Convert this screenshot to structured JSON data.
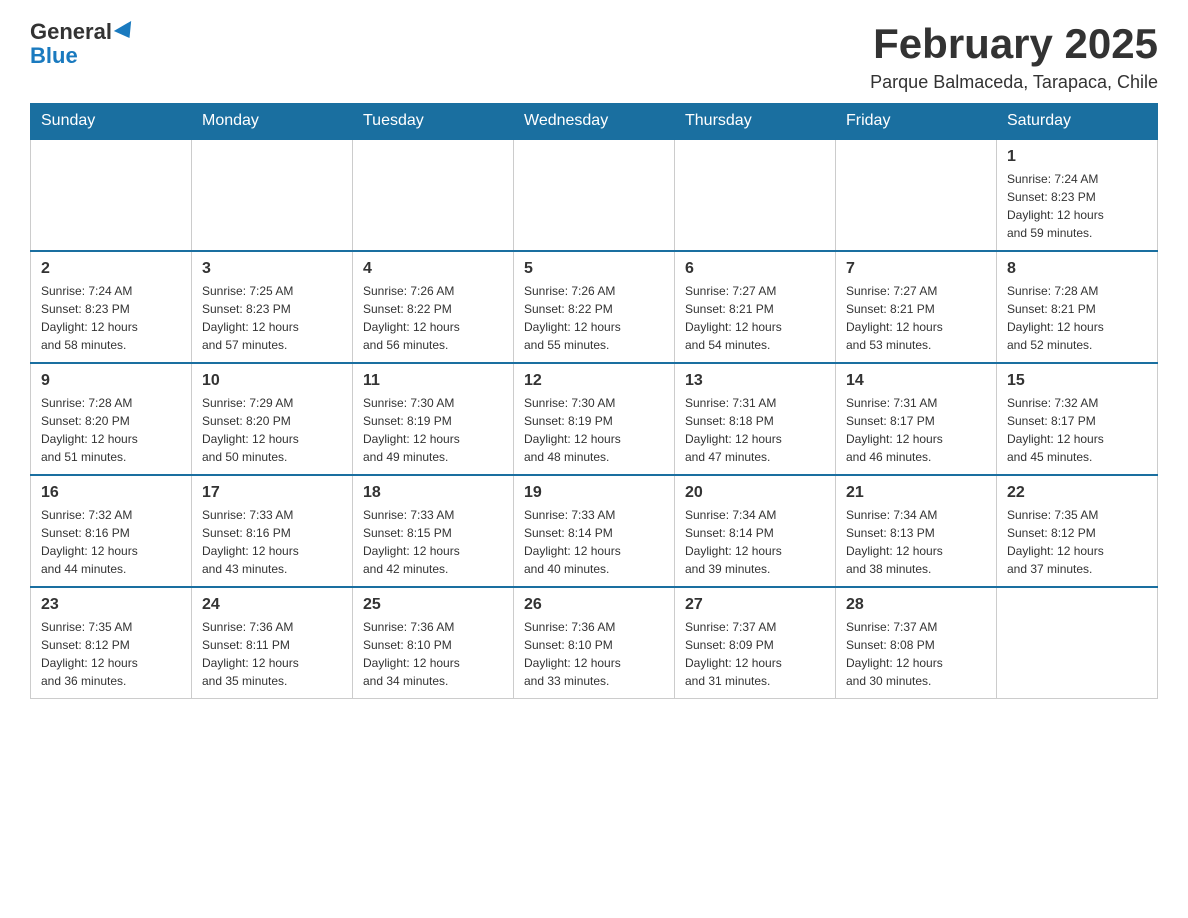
{
  "logo": {
    "general": "General",
    "blue": "Blue",
    "triangle_char": "▶"
  },
  "title": "February 2025",
  "subtitle": "Parque Balmaceda, Tarapaca, Chile",
  "days_of_week": [
    "Sunday",
    "Monday",
    "Tuesday",
    "Wednesday",
    "Thursday",
    "Friday",
    "Saturday"
  ],
  "weeks": [
    [
      {
        "day": "",
        "info": ""
      },
      {
        "day": "",
        "info": ""
      },
      {
        "day": "",
        "info": ""
      },
      {
        "day": "",
        "info": ""
      },
      {
        "day": "",
        "info": ""
      },
      {
        "day": "",
        "info": ""
      },
      {
        "day": "1",
        "info": "Sunrise: 7:24 AM\nSunset: 8:23 PM\nDaylight: 12 hours\nand 59 minutes."
      }
    ],
    [
      {
        "day": "2",
        "info": "Sunrise: 7:24 AM\nSunset: 8:23 PM\nDaylight: 12 hours\nand 58 minutes."
      },
      {
        "day": "3",
        "info": "Sunrise: 7:25 AM\nSunset: 8:23 PM\nDaylight: 12 hours\nand 57 minutes."
      },
      {
        "day": "4",
        "info": "Sunrise: 7:26 AM\nSunset: 8:22 PM\nDaylight: 12 hours\nand 56 minutes."
      },
      {
        "day": "5",
        "info": "Sunrise: 7:26 AM\nSunset: 8:22 PM\nDaylight: 12 hours\nand 55 minutes."
      },
      {
        "day": "6",
        "info": "Sunrise: 7:27 AM\nSunset: 8:21 PM\nDaylight: 12 hours\nand 54 minutes."
      },
      {
        "day": "7",
        "info": "Sunrise: 7:27 AM\nSunset: 8:21 PM\nDaylight: 12 hours\nand 53 minutes."
      },
      {
        "day": "8",
        "info": "Sunrise: 7:28 AM\nSunset: 8:21 PM\nDaylight: 12 hours\nand 52 minutes."
      }
    ],
    [
      {
        "day": "9",
        "info": "Sunrise: 7:28 AM\nSunset: 8:20 PM\nDaylight: 12 hours\nand 51 minutes."
      },
      {
        "day": "10",
        "info": "Sunrise: 7:29 AM\nSunset: 8:20 PM\nDaylight: 12 hours\nand 50 minutes."
      },
      {
        "day": "11",
        "info": "Sunrise: 7:30 AM\nSunset: 8:19 PM\nDaylight: 12 hours\nand 49 minutes."
      },
      {
        "day": "12",
        "info": "Sunrise: 7:30 AM\nSunset: 8:19 PM\nDaylight: 12 hours\nand 48 minutes."
      },
      {
        "day": "13",
        "info": "Sunrise: 7:31 AM\nSunset: 8:18 PM\nDaylight: 12 hours\nand 47 minutes."
      },
      {
        "day": "14",
        "info": "Sunrise: 7:31 AM\nSunset: 8:17 PM\nDaylight: 12 hours\nand 46 minutes."
      },
      {
        "day": "15",
        "info": "Sunrise: 7:32 AM\nSunset: 8:17 PM\nDaylight: 12 hours\nand 45 minutes."
      }
    ],
    [
      {
        "day": "16",
        "info": "Sunrise: 7:32 AM\nSunset: 8:16 PM\nDaylight: 12 hours\nand 44 minutes."
      },
      {
        "day": "17",
        "info": "Sunrise: 7:33 AM\nSunset: 8:16 PM\nDaylight: 12 hours\nand 43 minutes."
      },
      {
        "day": "18",
        "info": "Sunrise: 7:33 AM\nSunset: 8:15 PM\nDaylight: 12 hours\nand 42 minutes."
      },
      {
        "day": "19",
        "info": "Sunrise: 7:33 AM\nSunset: 8:14 PM\nDaylight: 12 hours\nand 40 minutes."
      },
      {
        "day": "20",
        "info": "Sunrise: 7:34 AM\nSunset: 8:14 PM\nDaylight: 12 hours\nand 39 minutes."
      },
      {
        "day": "21",
        "info": "Sunrise: 7:34 AM\nSunset: 8:13 PM\nDaylight: 12 hours\nand 38 minutes."
      },
      {
        "day": "22",
        "info": "Sunrise: 7:35 AM\nSunset: 8:12 PM\nDaylight: 12 hours\nand 37 minutes."
      }
    ],
    [
      {
        "day": "23",
        "info": "Sunrise: 7:35 AM\nSunset: 8:12 PM\nDaylight: 12 hours\nand 36 minutes."
      },
      {
        "day": "24",
        "info": "Sunrise: 7:36 AM\nSunset: 8:11 PM\nDaylight: 12 hours\nand 35 minutes."
      },
      {
        "day": "25",
        "info": "Sunrise: 7:36 AM\nSunset: 8:10 PM\nDaylight: 12 hours\nand 34 minutes."
      },
      {
        "day": "26",
        "info": "Sunrise: 7:36 AM\nSunset: 8:10 PM\nDaylight: 12 hours\nand 33 minutes."
      },
      {
        "day": "27",
        "info": "Sunrise: 7:37 AM\nSunset: 8:09 PM\nDaylight: 12 hours\nand 31 minutes."
      },
      {
        "day": "28",
        "info": "Sunrise: 7:37 AM\nSunset: 8:08 PM\nDaylight: 12 hours\nand 30 minutes."
      },
      {
        "day": "",
        "info": ""
      }
    ]
  ]
}
